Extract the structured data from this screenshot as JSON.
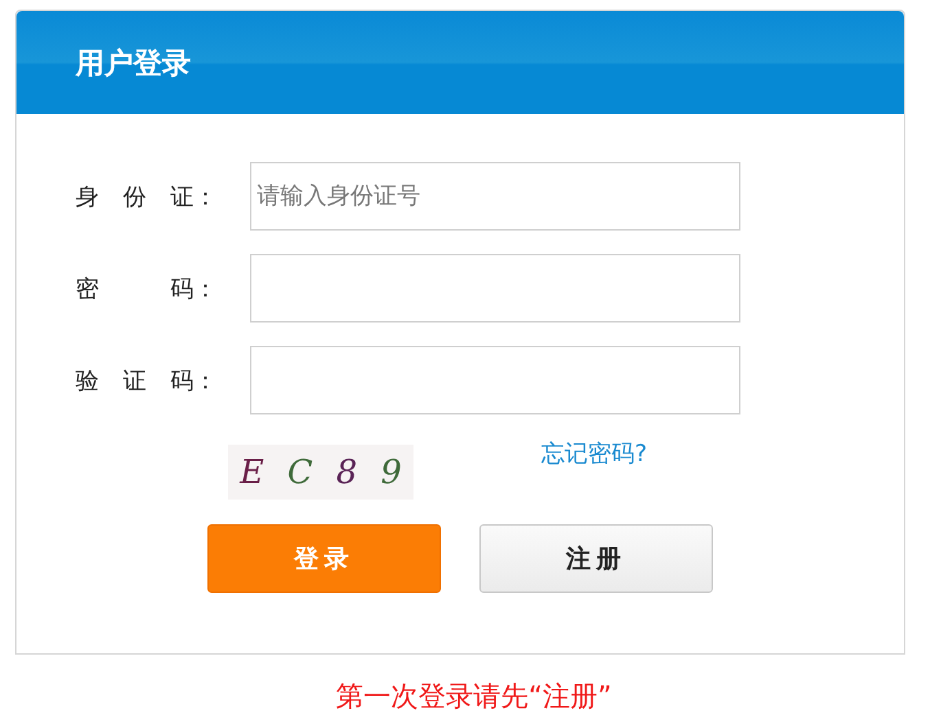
{
  "panel": {
    "title": "用户登录"
  },
  "fields": [
    {
      "label": "身 份 证：",
      "placeholder": "请输入身份证号"
    },
    {
      "label": "密   码："
    },
    {
      "label": "验 证 码："
    }
  ],
  "captcha": {
    "chars": [
      {
        "char": "E",
        "color": "#6a1f48"
      },
      {
        "char": "C",
        "color": "#3f6a3a"
      },
      {
        "char": "8",
        "color": "#5a2356"
      },
      {
        "char": "9",
        "color": "#3f6a3a"
      }
    ]
  },
  "forgot_link": "忘记密码?",
  "buttons": [
    {
      "label": "登录",
      "kind": "primary"
    },
    {
      "label": "注册",
      "kind": "secondary"
    }
  ],
  "footer_note": "第一次登录请先“注册”"
}
